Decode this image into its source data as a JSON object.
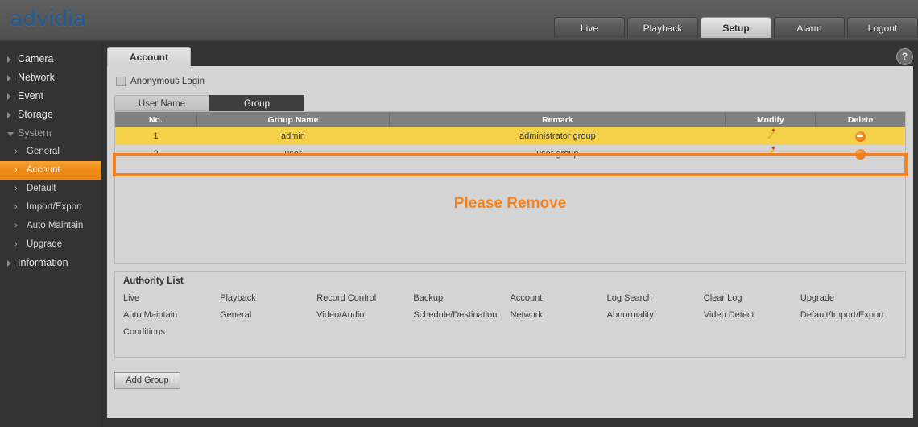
{
  "brand": {
    "logo_text": "advidia"
  },
  "nav": {
    "tabs": [
      {
        "label": "Live",
        "active": false
      },
      {
        "label": "Playback",
        "active": false
      },
      {
        "label": "Setup",
        "active": true
      },
      {
        "label": "Alarm",
        "active": false
      },
      {
        "label": "Logout",
        "active": false
      }
    ]
  },
  "sidebar": {
    "items": [
      {
        "label": "Camera"
      },
      {
        "label": "Network"
      },
      {
        "label": "Event"
      },
      {
        "label": "Storage"
      },
      {
        "label": "System"
      },
      {
        "label": "Information"
      }
    ],
    "system_subitems": [
      {
        "label": "General",
        "active": false
      },
      {
        "label": "Account",
        "active": true
      },
      {
        "label": "Default",
        "active": false
      },
      {
        "label": "Import/Export",
        "active": false
      },
      {
        "label": "Auto Maintain",
        "active": false
      },
      {
        "label": "Upgrade",
        "active": false
      }
    ]
  },
  "content": {
    "page_tab": "Account",
    "help_glyph": "?",
    "anonymous_login": {
      "label": "Anonymous Login",
      "checked": false
    },
    "subtabs": [
      {
        "label": "User Name",
        "active": false
      },
      {
        "label": "Group",
        "active": true
      }
    ],
    "table": {
      "headers": [
        "No.",
        "Group Name",
        "Remark",
        "Modify",
        "Delete"
      ],
      "rows": [
        {
          "no": "1",
          "group_name": "admin",
          "remark": "administrator group",
          "highlight": "yellow"
        },
        {
          "no": "2",
          "group_name": "user",
          "remark": "user group",
          "highlight": "none"
        }
      ]
    },
    "annotation": {
      "text": "Please Remove",
      "color": "#f5821f"
    },
    "authority": {
      "title": "Authority List",
      "items": [
        "Live",
        "Playback",
        "Record Control",
        "Backup",
        "Account",
        "Log Search",
        "Clear Log",
        "Upgrade",
        "Auto Maintain",
        "General",
        "Video/Audio",
        "Schedule/Destination",
        "Network",
        "Abnormality",
        "Video Detect",
        "Default/Import/Export",
        "Conditions"
      ]
    },
    "add_group_button": "Add Group"
  },
  "colors": {
    "accent_orange": "#f5821f",
    "row_highlight_yellow": "#f5d04a",
    "brand_blue": "#1f5c96"
  }
}
